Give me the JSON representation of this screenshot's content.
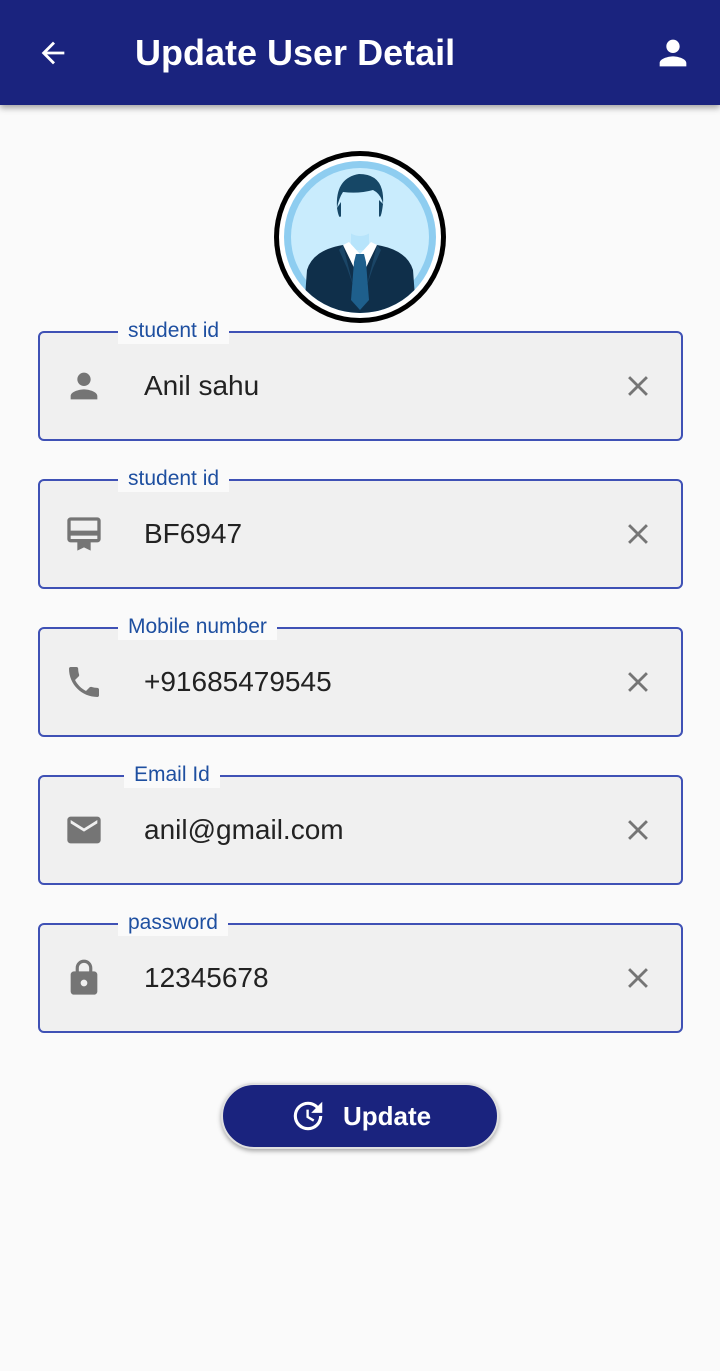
{
  "appbar": {
    "title": "Update User Detail",
    "back_icon": "arrow-back-icon",
    "account_icon": "person-icon",
    "color": "#1a237e"
  },
  "fields": [
    {
      "label": "student id",
      "value": "Anil sahu",
      "icon": "person-icon"
    },
    {
      "label": "student id",
      "value": "BF6947",
      "icon": "card-membership-icon"
    },
    {
      "label": "Mobile number",
      "value": "+91685479545",
      "icon": "phone-icon"
    },
    {
      "label": "Email Id",
      "value": "anil@gmail.com",
      "icon": "email-icon"
    },
    {
      "label": "password",
      "value": "12345678",
      "icon": "lock-icon"
    }
  ],
  "update_button": {
    "label": "Update",
    "icon": "update-icon"
  }
}
